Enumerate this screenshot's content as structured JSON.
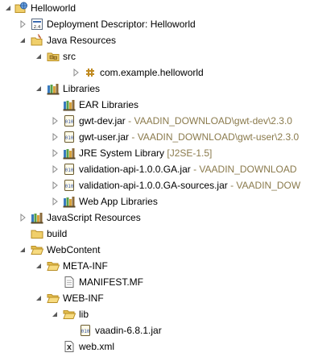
{
  "tree": {
    "project": {
      "label": "Helloworld",
      "icon": "web-project-icon"
    },
    "deployment_descriptor": {
      "label": "Deployment Descriptor: Helloworld",
      "icon": "deployment-descriptor-icon"
    },
    "java_resources": {
      "label": "Java Resources",
      "icon": "java-resources-icon"
    },
    "src": {
      "label": "src",
      "icon": "source-folder-icon"
    },
    "package": {
      "label": "com.example.helloworld",
      "icon": "package-icon"
    },
    "libraries": {
      "label": "Libraries",
      "icon": "libraries-icon"
    },
    "ear_libraries": {
      "label": "EAR Libraries",
      "icon": "library-container-icon"
    },
    "gwt_dev": {
      "label": "gwt-dev.jar",
      "decoration": " - VAADIN_DOWNLOAD\\gwt-dev\\2.3.0",
      "icon": "jar-icon"
    },
    "gwt_user": {
      "label": "gwt-user.jar",
      "decoration": " - VAADIN_DOWNLOAD\\gwt-user\\2.3.0",
      "icon": "jar-icon"
    },
    "jre": {
      "label": "JRE System Library",
      "decoration": " [J2SE-1.5]",
      "icon": "library-container-icon"
    },
    "validation_api": {
      "label": "validation-api-1.0.0.GA.jar",
      "decoration": " - VAADIN_DOWNLOAD",
      "icon": "jar-icon"
    },
    "validation_api_sources": {
      "label": "validation-api-1.0.0.GA-sources.jar",
      "decoration": " - VAADIN_DOW",
      "icon": "jar-icon"
    },
    "web_app_libraries": {
      "label": "Web App Libraries",
      "icon": "library-container-icon"
    },
    "js_resources": {
      "label": "JavaScript Resources",
      "icon": "javascript-resources-icon"
    },
    "build": {
      "label": "build",
      "icon": "folder-icon"
    },
    "webcontent": {
      "label": "WebContent",
      "icon": "folder-open-icon"
    },
    "meta_inf": {
      "label": "META-INF",
      "icon": "folder-open-icon"
    },
    "manifest": {
      "label": "MANIFEST.MF",
      "icon": "text-file-icon"
    },
    "web_inf": {
      "label": "WEB-INF",
      "icon": "folder-open-icon"
    },
    "lib": {
      "label": "lib",
      "icon": "folder-open-icon"
    },
    "vaadin_jar": {
      "label": "vaadin-6.8.1.jar",
      "icon": "jar-icon"
    },
    "web_xml": {
      "label": "web.xml",
      "icon": "xml-file-icon"
    }
  },
  "colors": {
    "decoration_text": "#8a7a4c",
    "folder": "#e8c35a",
    "jar": "#7e6b3e",
    "twisty": "#6a6a6a"
  }
}
